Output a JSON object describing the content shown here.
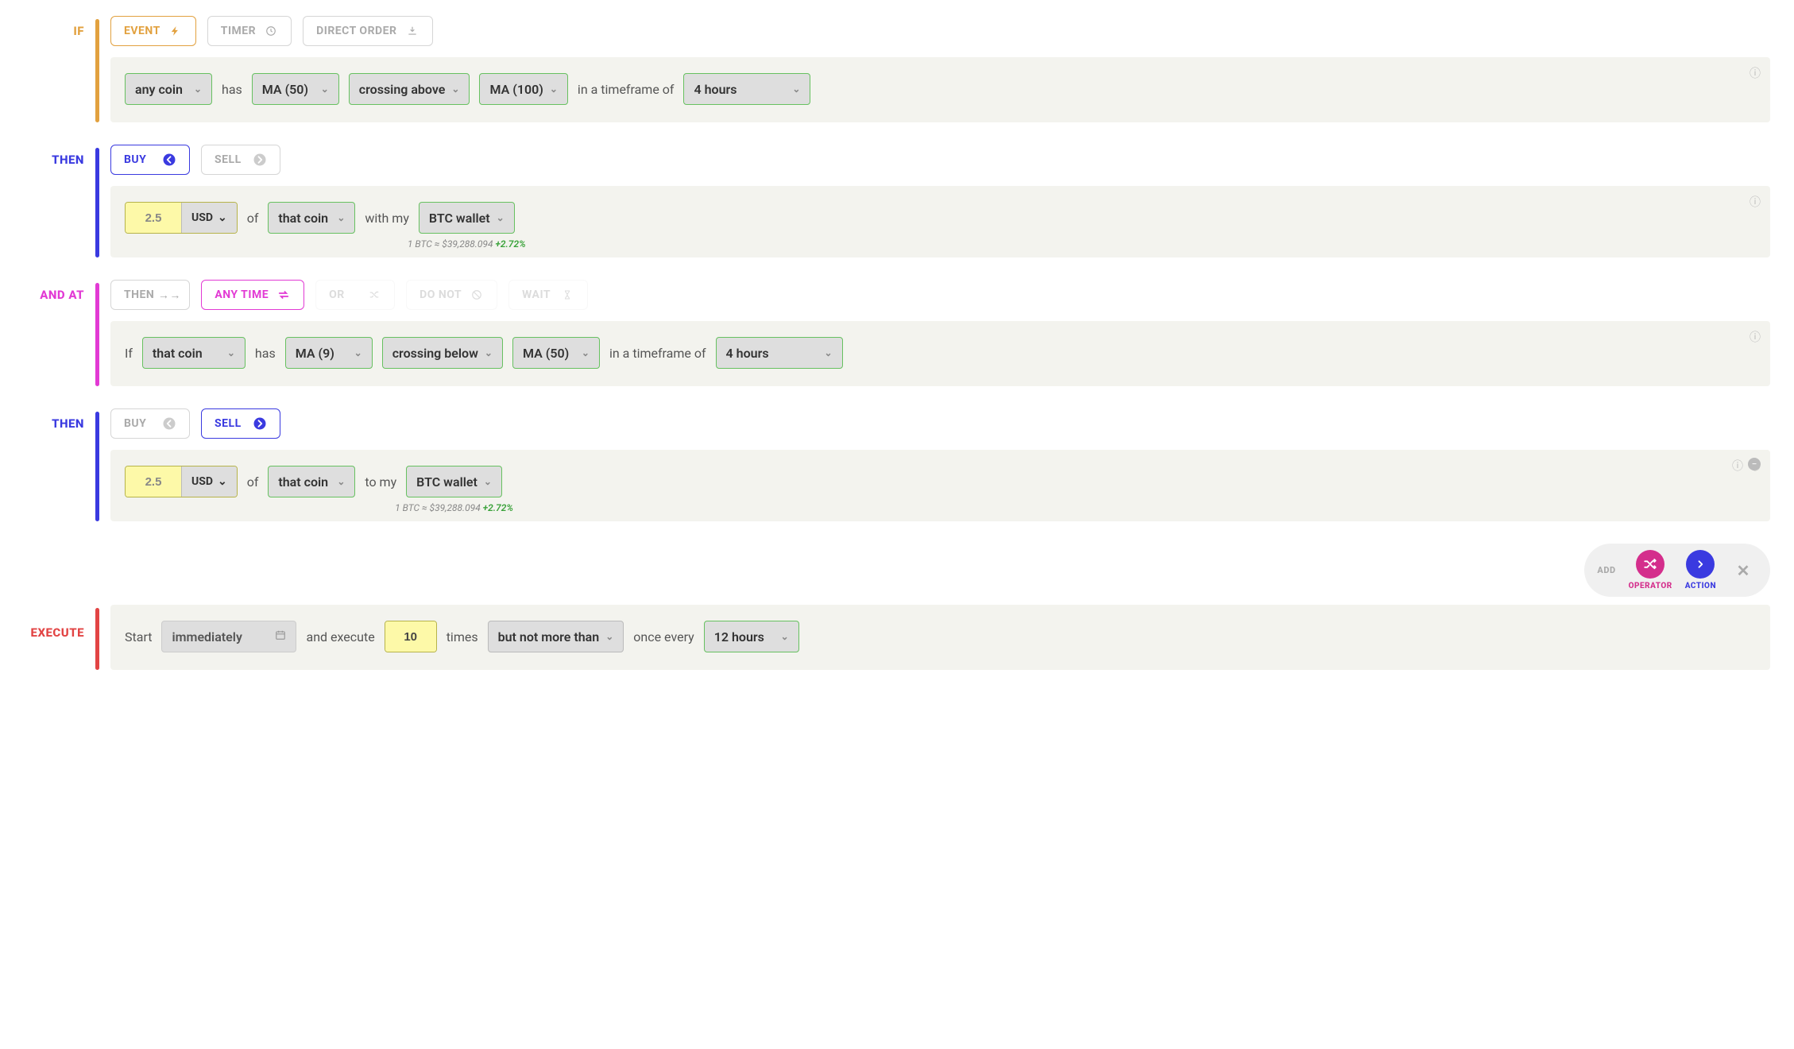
{
  "if": {
    "label": "IF",
    "pills": {
      "event": "EVENT",
      "timer": "TIMER",
      "direct": "DIRECT ORDER"
    },
    "coin": "any coin",
    "text_has": "has",
    "indicator1": "MA (50)",
    "condition": "crossing above",
    "indicator2": "MA (100)",
    "text_tf": "in a timeframe of",
    "timeframe": "4 hours"
  },
  "then1": {
    "label": "THEN",
    "pills": {
      "buy": "BUY",
      "sell": "SELL"
    },
    "amount": "2.5",
    "currency": "USD",
    "text_of": "of",
    "coin": "that coin",
    "text_with": "with my",
    "wallet": "BTC wallet",
    "note_prefix": "1 BTC ≈ $39,288.094",
    "note_pct": "+2.72%"
  },
  "andat": {
    "label": "AND AT",
    "pills": {
      "then": "THEN",
      "anytime": "ANY TIME",
      "or": "OR",
      "donot": "DO NOT",
      "wait": "WAIT"
    },
    "text_if": "If",
    "coin": "that coin",
    "text_has": "has",
    "indicator1": "MA (9)",
    "condition": "crossing below",
    "indicator2": "MA (50)",
    "text_tf": "in a timeframe of",
    "timeframe": "4 hours"
  },
  "then2": {
    "label": "THEN",
    "pills": {
      "buy": "BUY",
      "sell": "SELL"
    },
    "amount": "2.5",
    "currency": "USD",
    "text_of": "of",
    "coin": "that coin",
    "text_to": "to my",
    "wallet": "BTC wallet",
    "note_prefix": "1 BTC ≈ $39,288.094",
    "note_pct": "+2.72%"
  },
  "add_bar": {
    "add": "ADD",
    "operator": "OPERATOR",
    "action": "ACTION"
  },
  "execute": {
    "label": "EXECUTE",
    "text_start": "Start",
    "when": "immediately",
    "text_exec": "and execute",
    "count": "10",
    "text_times": "times",
    "limit": "but not more than",
    "text_every": "once every",
    "interval": "12 hours"
  }
}
